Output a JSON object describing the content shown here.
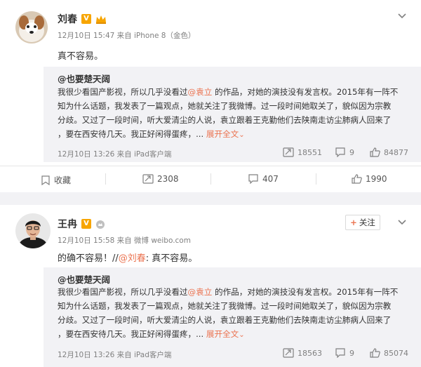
{
  "post1": {
    "author": "刘春",
    "meta": "12月10日 15:47 来自 iPhone 8（金色）",
    "text": "真不容易。",
    "quote": {
      "author": "@也要楚天阔",
      "line1_a": "我很少看国产影视，所以几乎没看过",
      "mention": "@袁立",
      "line1_b": " 的作品，对她的演技没有发言权。2015年有一阵不",
      "line2": "知为什么话题，我发表了一篇观点，她就关注了我微博。过一段时间她取关了，貌似因为宗教",
      "line3": "分歧。又过了一段时间，听大爱清尘的人说，袁立跟着王克勤他们去陕南走访尘肺病人回来了",
      "line4": "，要在西安待几天。我正好闲得蛋疼，...",
      "more": "展开全文",
      "more_arrow": "⌄",
      "meta": "12月10日 13:26 来自 iPad客户端",
      "reposts": "18551",
      "comments": "9",
      "likes": "84877"
    },
    "actions": {
      "favorite": "收藏",
      "reposts": "2308",
      "comments": "407",
      "likes": "1990"
    }
  },
  "post2": {
    "author": "王冉",
    "meta": "12月10日 15:58 来自 微博 weibo.com",
    "follow_plus": "+",
    "follow_label": "关注",
    "text_a": "的确不容易！//",
    "text_mention": "@刘春",
    "text_b": ": 真不容易。",
    "quote": {
      "author": "@也要楚天阔",
      "line1_a": "我很少看国产影视，所以几乎没看过",
      "mention": "@袁立",
      "line1_b": " 的作品，对她的演技没有发言权。2015年有一阵不",
      "line2": "知为什么话题，我发表了一篇观点，她就关注了我微博。过一段时间她取关了，貌似因为宗教",
      "line3": "分歧。又过了一段时间，听大爱清尘的人说，袁立跟着王克勤他们去陕南走访尘肺病人回来了",
      "line4": "，要在西安待几天。我正好闲得蛋疼，...",
      "more": "展开全文",
      "more_arrow": "⌄",
      "meta": "12月10日 13:26 来自 iPad客户端",
      "reposts": "18563",
      "comments": "9",
      "likes": "85074"
    }
  },
  "colors": {
    "accent": "#eb7350",
    "quote_bg": "#f2f2f5",
    "meta": "#808080",
    "vip": "#f7a500"
  }
}
